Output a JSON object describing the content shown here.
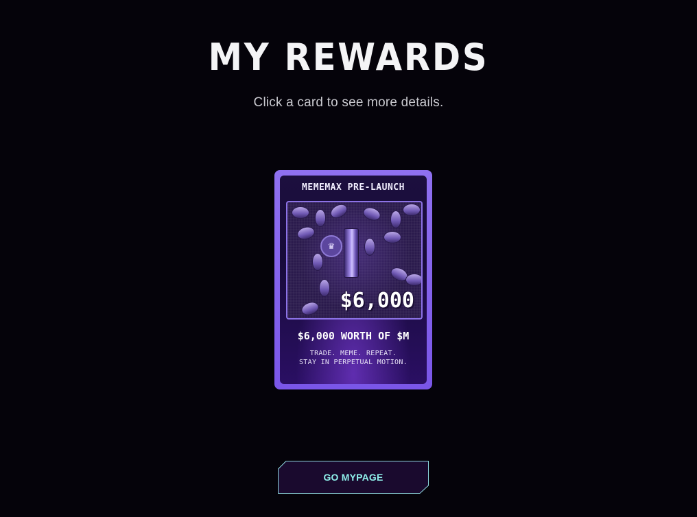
{
  "page": {
    "title": "MY REWARDS",
    "subtitle": "Click a card to see more details."
  },
  "reward_card": {
    "header": "MEMEMAX PRE-LAUNCH",
    "amount": "$6,000",
    "worth": "$6,000 WORTH OF $M",
    "tagline_line1": "TRADE. MEME. REPEAT.",
    "tagline_line2": "STAY IN PERPETUAL MOTION."
  },
  "footer": {
    "button_label": "GO MYPAGE"
  },
  "colors": {
    "background": "#05030a",
    "card_frame": "#8f70f0",
    "button_border": "#8fd8e0",
    "button_text": "#8ff0ea",
    "button_fill": "#1a0a2e"
  },
  "icons": {
    "crown": "crown-icon",
    "coin": "coin-icon"
  }
}
